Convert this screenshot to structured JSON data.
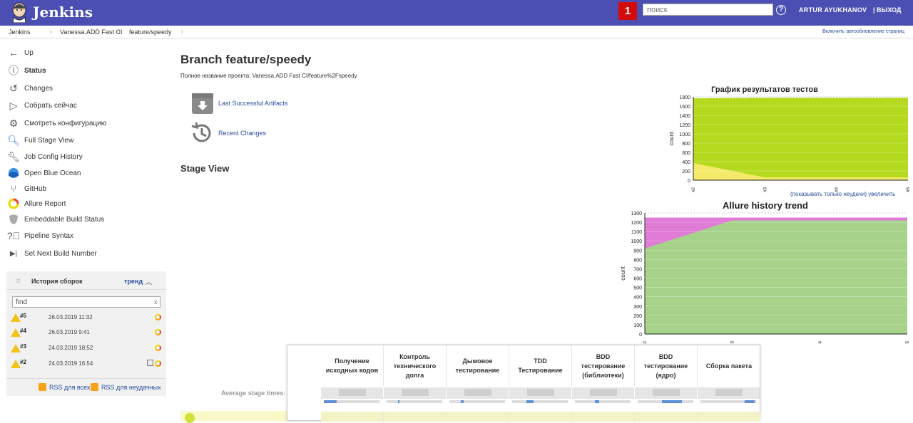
{
  "header": {
    "app_title": "Jenkins",
    "notifications": "1",
    "search_placeholder": "поиск",
    "help": "?",
    "user": "ARTUR AYUKHANOV",
    "logout": "| ВЫХОД",
    "bg": "#4b4fb3",
    "notif_color": "#d20b0b"
  },
  "breadcrumbs": {
    "items": [
      "Jenkins",
      "Vanessa.ADD Fast CI",
      "feature/speedy"
    ],
    "auto_refresh": "Включить автообновление страниц"
  },
  "sidebar": {
    "items": [
      {
        "label": "Up",
        "icon": "arrow-left-icon",
        "bold": false
      },
      {
        "label": "Status",
        "icon": "info-icon",
        "bold": true
      },
      {
        "label": "Changes",
        "icon": "history-icon",
        "bold": false
      },
      {
        "label": "Собрать сейчас",
        "icon": "play-icon",
        "bold": false
      },
      {
        "label": "Смотреть конфигурацию",
        "icon": "gear-icon",
        "bold": false
      },
      {
        "label": "Full Stage View",
        "icon": "magnifier-icon",
        "bold": false
      },
      {
        "label": "Job Config History",
        "icon": "wrench-icon",
        "bold": false
      },
      {
        "label": "Open Blue Ocean",
        "icon": "blue-ocean-icon",
        "bold": false
      },
      {
        "label": "GitHub",
        "icon": "git-branch-icon",
        "bold": false
      },
      {
        "label": "Allure Report",
        "icon": "allure-icon",
        "bold": false
      },
      {
        "label": "Embeddable Build Status",
        "icon": "shield-icon",
        "bold": false
      },
      {
        "label": "Pipeline Syntax",
        "icon": "help-circle-icon",
        "bold": false
      },
      {
        "label": "Set Next Build Number",
        "icon": "next-icon",
        "bold": false
      }
    ]
  },
  "history": {
    "title": "История сборок",
    "trend": "тренд",
    "find_value": "find",
    "clear": "x",
    "builds": [
      {
        "num": "#5",
        "date": "26.03.2019 11:32"
      },
      {
        "num": "#4",
        "date": "26.03.2019 9:41"
      },
      {
        "num": "#3",
        "date": "24.03.2019 18:52"
      },
      {
        "num": "#2",
        "date": "24.03.2019 16:54"
      }
    ],
    "rss_all": "RSS для всех",
    "rss_fail": "RSS для неудачных"
  },
  "main": {
    "title": "Branch feature/speedy",
    "full_name": "Полное название проекта: Vanessa.ADD Fast CI/feature%2Fspeedy",
    "artifacts": "Last Successful Artifacts",
    "recent": "Recent Changes",
    "stage_view": "Stage View",
    "avg_times": "Average stage times:"
  },
  "charts_text": {
    "test_links": "(показывать только неудачи) увеличить"
  },
  "stages": [
    "Получение исходных кодов",
    "Контроль технического долга",
    "Дымовое тестирование",
    "TDD Тестирование",
    "BDD тестирование (библиотеки)",
    "BDD тестирование (ядро)",
    "Сборка пакета"
  ],
  "chart_data": [
    {
      "type": "area",
      "title": "График результатов тестов",
      "xlabel": "",
      "ylabel": "count",
      "x": [
        "#2",
        "#3",
        "#4",
        "#5"
      ],
      "ylim": [
        0,
        1800
      ],
      "series": [
        {
          "values": [
            370,
            60,
            60,
            60
          ],
          "color": "#f5e96a"
        },
        {
          "values": [
            1770,
            1780,
            1780,
            1780
          ],
          "color": "#b5d91e"
        }
      ]
    },
    {
      "type": "area",
      "title": "Allure history trend",
      "xlabel": "",
      "ylabel": "count",
      "x": [
        "#2",
        "#3",
        "#4",
        "#5"
      ],
      "ylim": [
        0,
        1300
      ],
      "series": [
        {
          "values": [
            920,
            1220,
            1220,
            1220
          ],
          "color": "#a6d28a"
        },
        {
          "values": [
            960,
            1250,
            1250,
            1250
          ],
          "color": "#b0b0b0"
        },
        {
          "values": [
            1250,
            1250,
            1250,
            1250
          ],
          "color": "#e07bd6"
        }
      ]
    }
  ]
}
